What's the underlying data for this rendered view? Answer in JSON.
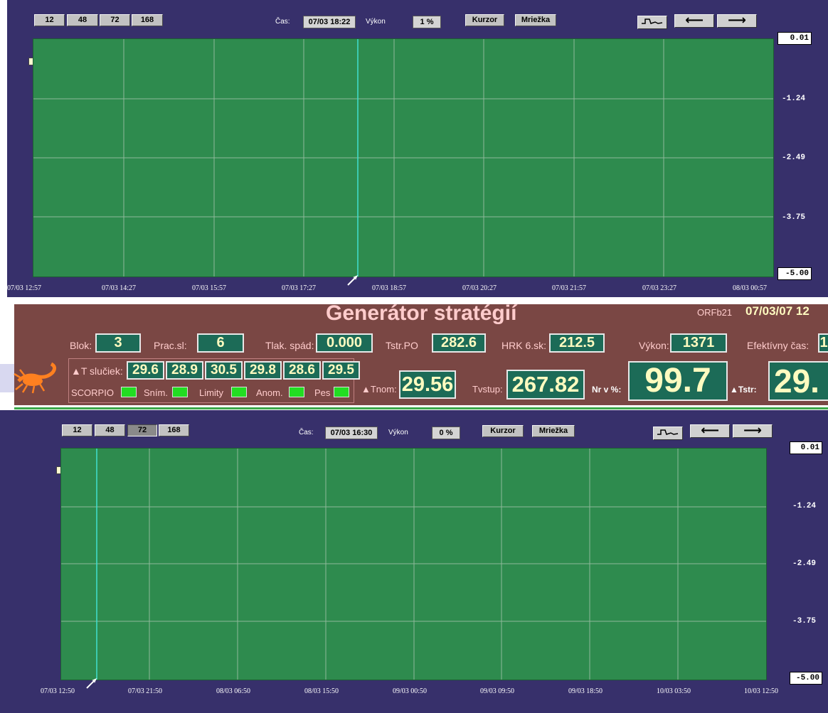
{
  "top": {
    "range_buttons": [
      "12",
      "48",
      "72",
      "168"
    ],
    "cas_label": "Čas:",
    "cas_value": "07/03 18:22",
    "vykon_label": "Výkon",
    "vykon_value": "1 %",
    "kurzor_label": "Kurzor",
    "mriezka_label": "Mriežka",
    "y_ticks": [
      "0.01",
      "-1.24",
      "-2.49",
      "-3.75",
      "-5.00"
    ],
    "x_ticks": [
      "07/03 12:57",
      "07/03 14:27",
      "07/03 15:57",
      "07/03 17:27",
      "07/03 18:57",
      "07/03 20:27",
      "07/03 21:57",
      "07/03 23:27",
      "08/03 00:57"
    ]
  },
  "status": {
    "title": "Generátor stratégií",
    "station": "ORFb21",
    "datetime": "07/03/07 12",
    "blok_label": "Blok:",
    "blok_value": "3",
    "pracsl_label": "Prac.sl:",
    "pracsl_value": "6",
    "tlak_label": "Tlak. spád:",
    "tlak_value": "0.000",
    "tstr_po_label": "Tstr.PO",
    "tstr_po_value": "282.6",
    "hrk_label": "HRK 6.sk:",
    "hrk_value": "212.5",
    "vykon_label": "Výkon:",
    "vykon_value": "1371",
    "efekt_label": "Efektívny čas:",
    "efekt_value": "1",
    "dt_sluciek_label": "▲T slučiek:",
    "dt_sluciek": [
      "29.6",
      "28.9",
      "30.5",
      "29.8",
      "28.6",
      "29.5"
    ],
    "tnom_label": "▲Tnom:",
    "tnom_value": "29.56",
    "tvstup_label": "Tvstup:",
    "tvstup_value": "267.82",
    "nr_label": "Nr v %:",
    "nr_value": "99.7",
    "dtstr_label": "▲Tstr:",
    "dtstr_value": "29.",
    "indicators": [
      "SCORPIO",
      "Sním.",
      "Limity",
      "Anom.",
      "Pes"
    ]
  },
  "bottom": {
    "range_buttons": [
      "12",
      "48",
      "72",
      "168"
    ],
    "cas_label": "Čas:",
    "cas_value": "07/03 16:30",
    "vykon_label": "Výkon",
    "vykon_value": "0 %",
    "kurzor_label": "Kurzor",
    "mriezka_label": "Mriežka",
    "y_ticks": [
      "0.01",
      "-1.24",
      "-2.49",
      "-3.75",
      "-5.00"
    ],
    "x_ticks": [
      "07/03 12:50",
      "07/03 21:50",
      "08/03 06:50",
      "08/03 15:50",
      "09/03 00:50",
      "09/03 09:50",
      "09/03 18:50",
      "10/03 03:50",
      "10/03 12:50"
    ]
  },
  "colors": {
    "panel": "#37306b",
    "plot": "#2e8b4e",
    "cursor": "#40e0d0",
    "status_bg": "#7a4744",
    "value_box": "#1c6b57",
    "indicator": "#22dd22"
  }
}
